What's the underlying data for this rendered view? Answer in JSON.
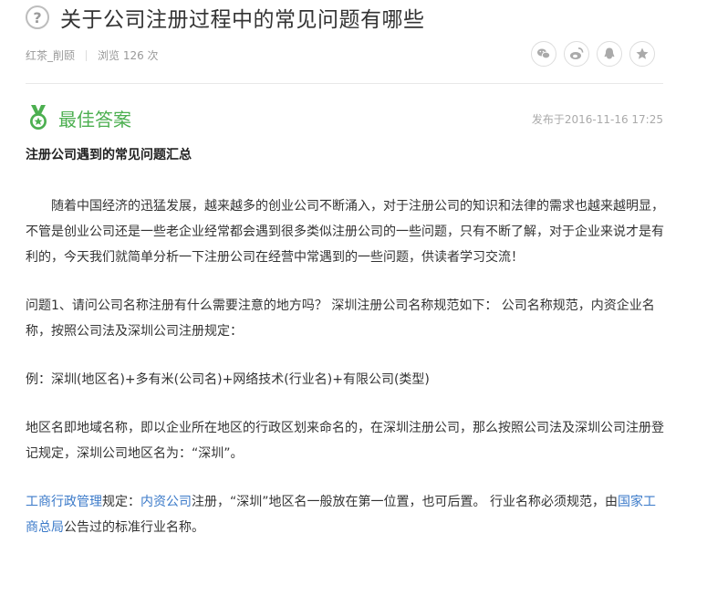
{
  "question": {
    "title": "关于公司注册过程中的常见问题有哪些",
    "author": "红茶_削颐",
    "views": "浏览 126 次"
  },
  "share": [
    {
      "name": "wechat-icon"
    },
    {
      "name": "weibo-icon"
    },
    {
      "name": "qq-icon"
    },
    {
      "name": "favorite-icon"
    }
  ],
  "answer": {
    "label": "最佳答案",
    "published": "发布于2016-11-16 17:25",
    "heading": "注册公司遇到的常见问题汇总",
    "p1": "随着中国经济的迅猛发展，越来越多的创业公司不断涌入，对于注册公司的知识和法律的需求也越来越明显，不管是创业公司还是一些老企业经常都会遇到很多类似注册公司的一些问题，只有不断了解，对于企业来说才是有利的，今天我们就简单分析一下注册公司在经营中常遇到的一些问题，供读者学习交流！",
    "p2": "问题1、请问公司名称注册有什么需要注意的地方吗？ 深圳注册公司名称规范如下： 公司名称规范，内资企业名称，按照公司法及深圳公司注册规定：",
    "p3": "例：深圳(地区名)+多有米(公司名)+网络技术(行业名)+有限公司(类型)",
    "p4": "地区名即地域名称，即以企业所在地区的行政区划来命名的，在深圳注册公司，那么按照公司法及深圳公司注册登记规定，深圳公司地区名为：“深圳”。",
    "p5": {
      "link1": "工商行政管理",
      "t1": "规定：",
      "link2": "内资公司",
      "t2": "注册，“深圳”地区名一般放在第一位置，也可后置。 行业名称必须规范，由",
      "link3": "国家工商总局",
      "t3": "公告过的标准行业名称。"
    }
  },
  "colors": {
    "accent_green": "#4caf50",
    "link_blue": "#3b7ac9"
  }
}
